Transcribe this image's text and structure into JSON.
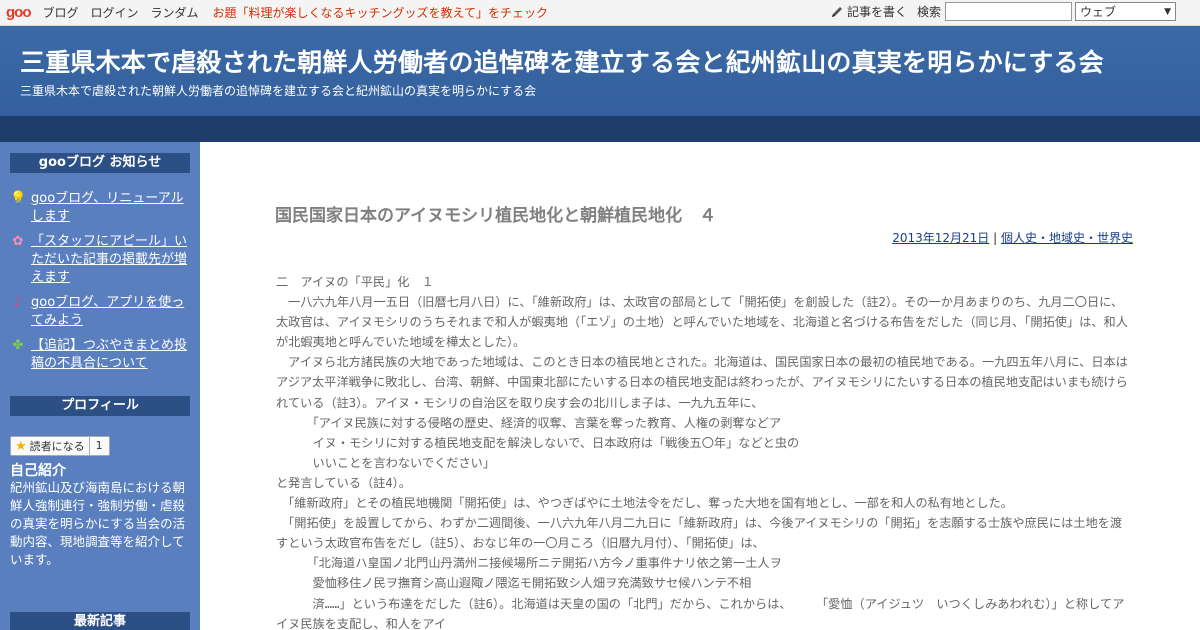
{
  "topbar": {
    "logo": "goo",
    "nav": [
      "ブログ",
      "ログイン",
      "ランダム"
    ],
    "topic": "お題「料理が楽しくなるキッチングッズを教えて」をチェック",
    "write": "記事を書く",
    "search_label": "検索",
    "search_value": "",
    "select_value": "ウェブ"
  },
  "header": {
    "title": "三重県木本で虐殺された朝鮮人労働者の追悼碑を建立する会と紀州鉱山の真実を明らかにする会",
    "description": "三重県木本で虐殺された朝鮮人労働者の追悼碑を建立する会と紀州鉱山の真実を明らかにする会"
  },
  "sidebar": {
    "notice_title": "gooブログ お知らせ",
    "notices": [
      {
        "icon": "lightbulb-icon",
        "label": "gooブログ、リニューアルします"
      },
      {
        "icon": "flower-icon",
        "label": "「スタッフにアピール」いただいた記事の掲載先が増えます"
      },
      {
        "icon": "music-note-icon",
        "label": "gooブログ、アプリを使ってみよう"
      },
      {
        "icon": "clover-icon",
        "label": "【追記】つぶやきまとめ投稿の不具合について"
      }
    ],
    "profile_title": "プロフィール",
    "reader_label": "読者になる",
    "reader_count": "1",
    "intro_title": "自己紹介",
    "intro_body": "紀州鉱山及び海南島における朝鮮人強制連行・強制労働・虐殺の真実を明らかにする当会の活動内容、現地調査等を紹介しています。",
    "recent_title": "最新記事"
  },
  "post": {
    "title": "国民国家日本のアイヌモシリ植民地化と朝鮮植民地化　４",
    "date": "2013年12月21日",
    "separator": " | ",
    "category": "個人史・地域史・世界史",
    "lines": [
      "二　アイヌの「平民」化　１",
      "　一八六九年八月一五日（旧暦七月八日）に、「維新政府」は、太政官の部局として「開拓使」を創設した（註2）。その一か月あまりのち、九月二〇日に、太政官は、アイヌモシリのうちそれまで和人が蝦夷地（「エゾ」の土地）と呼んでいた地域を、北海道と名づける布告をだした（同じ月、「開拓使」は、和人が北蝦夷地と呼んでいた地域を樺太とした）。",
      "　アイヌら北方諸民族の大地であった地域は、このとき日本の植民地とされた。北海道は、国民国家日本の最初の植民地である。一九四五年八月に、日本はアジア太平洋戦争に敗北し、台湾、朝鮮、中国東北部にたいする日本の植民地支配は終わったが、アイヌモシリにたいする日本の植民地支配はいまも続けられている（註3）。アイヌ・モシリの自治区を取り戻す会の北川しま子は、一九九五年に、",
      "　　　「アイヌ民族に対する侵略の歴史、経済的収奪、言葉を奪った教育、人権の剥奪などア",
      "　　　イヌ・モシリに対する植民地支配を解決しないで、日本政府は「戦後五〇年」などと虫の",
      "　　　いいことを言わないでください」",
      "と発言している（註4）。",
      "　「維新政府」とその植民地機関「開拓使」は、やつぎばやに土地法令をだし、奪った大地を国有地とし、一部を和人の私有地とした。",
      "　「開拓使」を設置してから、わずか二週間後、一八六九年八月二九日に「維新政府」は、今後アイヌモシリの「開拓」を志願する士族や庶民には土地を渡すという太政官布告をだし（註5）、おなじ年の一〇月ころ（旧暦九月付）、「開拓使」は、",
      "　　　「北海道ハ皇国ノ北門山丹満州ニ接候場所ニテ開拓ハ方今ノ重事件ナリ依之第一土人ヲ",
      "　　　愛恤移住ノ民ヲ撫育シ高山遐陬ノ隈迄モ開拓致シ人畑ヲ充満致サセ候ハンテ不相",
      "　　　済……」という布達をだした（註6）。北海道は天皇の国の「北門」だから、これからは、　　　「愛恤（アイジュツ　いつくしみあわれむ）」と称してアイヌ民族を支配し、和人をアイ"
    ]
  }
}
